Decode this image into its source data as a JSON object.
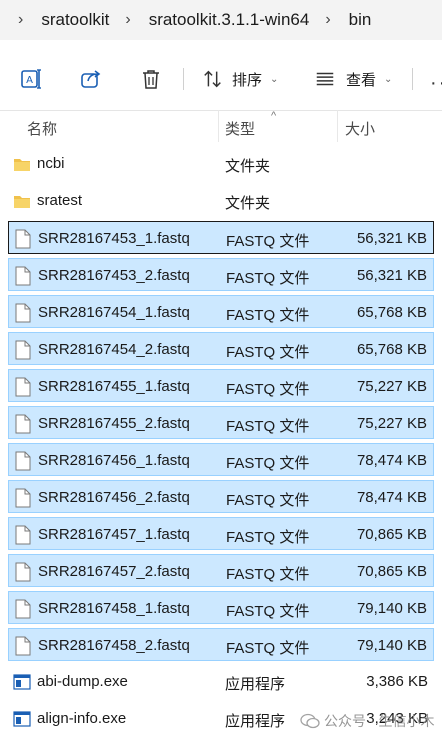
{
  "breadcrumb": {
    "items": [
      "sratoolkit",
      "sratoolkit.3.1.1-win64",
      "bin"
    ],
    "separator": "›"
  },
  "toolbar": {
    "sort_label": "排序",
    "view_label": "查看",
    "chevron": "⌄",
    "more": "··"
  },
  "columns": {
    "name": "名称",
    "type": "类型",
    "size": "大小",
    "sort_caret": "^"
  },
  "rows": [
    {
      "name": "ncbi",
      "type": "文件夹",
      "size": "",
      "icon": "folder-icon",
      "selected": false
    },
    {
      "name": "sratest",
      "type": "文件夹",
      "size": "",
      "icon": "folder-icon",
      "selected": false
    },
    {
      "name": "SRR28167453_1.fastq",
      "type": "FASTQ 文件",
      "size": "56,321 KB",
      "icon": "file-icon",
      "selected": true,
      "focused": true
    },
    {
      "name": "SRR28167453_2.fastq",
      "type": "FASTQ 文件",
      "size": "56,321 KB",
      "icon": "file-icon",
      "selected": true
    },
    {
      "name": "SRR28167454_1.fastq",
      "type": "FASTQ 文件",
      "size": "65,768 KB",
      "icon": "file-icon",
      "selected": true
    },
    {
      "name": "SRR28167454_2.fastq",
      "type": "FASTQ 文件",
      "size": "65,768 KB",
      "icon": "file-icon",
      "selected": true
    },
    {
      "name": "SRR28167455_1.fastq",
      "type": "FASTQ 文件",
      "size": "75,227 KB",
      "icon": "file-icon",
      "selected": true
    },
    {
      "name": "SRR28167455_2.fastq",
      "type": "FASTQ 文件",
      "size": "75,227 KB",
      "icon": "file-icon",
      "selected": true
    },
    {
      "name": "SRR28167456_1.fastq",
      "type": "FASTQ 文件",
      "size": "78,474 KB",
      "icon": "file-icon",
      "selected": true
    },
    {
      "name": "SRR28167456_2.fastq",
      "type": "FASTQ 文件",
      "size": "78,474 KB",
      "icon": "file-icon",
      "selected": true
    },
    {
      "name": "SRR28167457_1.fastq",
      "type": "FASTQ 文件",
      "size": "70,865 KB",
      "icon": "file-icon",
      "selected": true
    },
    {
      "name": "SRR28167457_2.fastq",
      "type": "FASTQ 文件",
      "size": "70,865 KB",
      "icon": "file-icon",
      "selected": true
    },
    {
      "name": "SRR28167458_1.fastq",
      "type": "FASTQ 文件",
      "size": "79,140 KB",
      "icon": "file-icon",
      "selected": true
    },
    {
      "name": "SRR28167458_2.fastq",
      "type": "FASTQ 文件",
      "size": "79,140 KB",
      "icon": "file-icon",
      "selected": true
    },
    {
      "name": "abi-dump.exe",
      "type": "应用程序",
      "size": "3,386 KB",
      "icon": "exe-icon",
      "selected": false
    },
    {
      "name": "align-info.exe",
      "type": "应用程序",
      "size": "3,243 KB",
      "icon": "exe-icon",
      "selected": false
    }
  ],
  "watermark": {
    "text": "公众号 · 生信小木"
  },
  "colors": {
    "selection_fill": "#cce8ff",
    "selection_border": "#99d1ff",
    "folder": "#f0c14b",
    "accent": "#0067c0"
  }
}
